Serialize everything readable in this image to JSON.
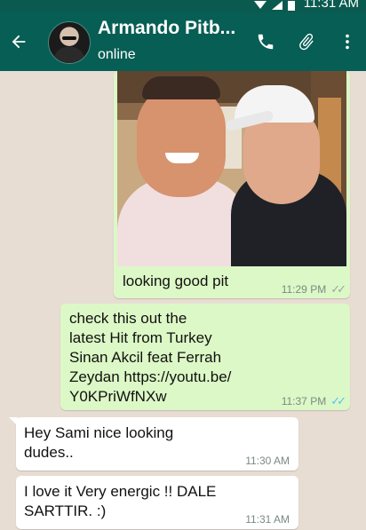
{
  "status_bar": {
    "time": "11:31 AM"
  },
  "header": {
    "contact_name": "Armando Pitb...",
    "status": "online"
  },
  "colors": {
    "app_bar": "#075e54",
    "outgoing_bubble": "#dcf8c6",
    "incoming_bubble": "#ffffff",
    "read_ticks": "#4fc3f7"
  },
  "messages": [
    {
      "type": "image",
      "direction": "outgoing",
      "caption": "looking good pit",
      "time": "11:29 PM",
      "status": "read"
    },
    {
      "type": "text",
      "direction": "outgoing",
      "text": "check this out the\nlatest Hit from Turkey\nSinan Akcil feat Ferrah\nZeydan https://youtu.be/\nY0KPriWfNXw",
      "time": "11:37 PM",
      "status": "read"
    },
    {
      "type": "text",
      "direction": "incoming",
      "text": "Hey Sami nice looking\ndudes..",
      "time": "11:30 AM"
    },
    {
      "type": "text",
      "direction": "incoming",
      "text": "I love it Very energic !! DALE\nSARTTIR. :)",
      "time": "11:31 AM"
    }
  ]
}
